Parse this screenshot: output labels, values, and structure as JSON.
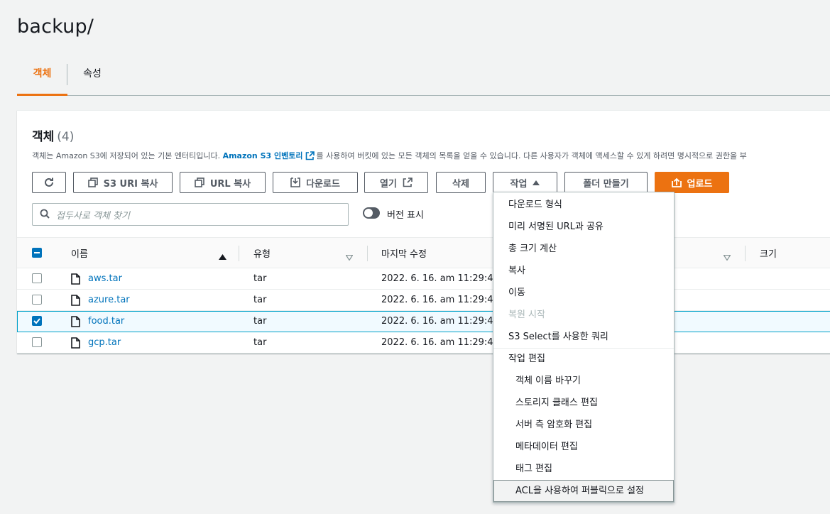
{
  "page_title": "backup/",
  "tabs": [
    {
      "label": "객체",
      "active": true
    },
    {
      "label": "속성",
      "active": false
    }
  ],
  "objects": {
    "title": "객체",
    "count": "(4)",
    "desc_before": "객체는 Amazon S3에 저장되어 있는 기본 엔터티입니다.",
    "desc_link": "Amazon S3 인벤토리",
    "desc_after": "를 사용하여 버킷에 있는 모든 객체의 목록을 얻을 수 있습니다. 다른 사용자가 객체에 액세스할 수 있게 하려면 명시적으로 권한을 부"
  },
  "toolbar": {
    "refresh_icon": "refresh-icon",
    "s3_uri": "S3 URI 복사",
    "url_copy": "URL 복사",
    "download": "다운로드",
    "open": "열기",
    "delete": "삭제",
    "actions": "작업",
    "create_folder": "폴더 만들기",
    "upload": "업로드"
  },
  "search": {
    "placeholder": "접두사로 객체 찾기",
    "version_toggle": "버전 표시"
  },
  "table": {
    "columns": [
      "이름",
      "유형",
      "마지막 수정",
      "크기"
    ],
    "rows": [
      {
        "name": "aws.tar",
        "type": "tar",
        "modified": "2022. 6. 16. am 11:29:41",
        "selected": false
      },
      {
        "name": "azure.tar",
        "type": "tar",
        "modified": "2022. 6. 16. am 11:29:41",
        "selected": false
      },
      {
        "name": "food.tar",
        "type": "tar",
        "modified": "2022. 6. 16. am 11:29:41",
        "selected": true
      },
      {
        "name": "gcp.tar",
        "type": "tar",
        "modified": "2022. 6. 16. am 11:29:41",
        "selected": false
      }
    ]
  },
  "actions_menu": {
    "items": [
      {
        "label": "다운로드 형식",
        "disabled": false
      },
      {
        "label": "미리 서명된 URL과 공유",
        "disabled": false
      },
      {
        "label": "총 크기 계산",
        "disabled": false
      },
      {
        "label": "복사",
        "disabled": false
      },
      {
        "label": "이동",
        "disabled": false
      },
      {
        "label": "복원 시작",
        "disabled": true
      },
      {
        "label": "S3 Select를 사용한 쿼리",
        "disabled": false
      }
    ],
    "group_label": "작업 편집",
    "sub_items": [
      {
        "label": "객체 이름 바꾸기"
      },
      {
        "label": "스토리지 클래스 편집"
      },
      {
        "label": "서버 측 암호화 편집"
      },
      {
        "label": "메타데이터 편집"
      },
      {
        "label": "태그 편집"
      },
      {
        "label": "ACL을 사용하여 퍼블릭으로 설정"
      }
    ]
  },
  "colors": {
    "accent": "#ec7211",
    "link": "#0073bb",
    "selected_border": "#00a1c9"
  }
}
